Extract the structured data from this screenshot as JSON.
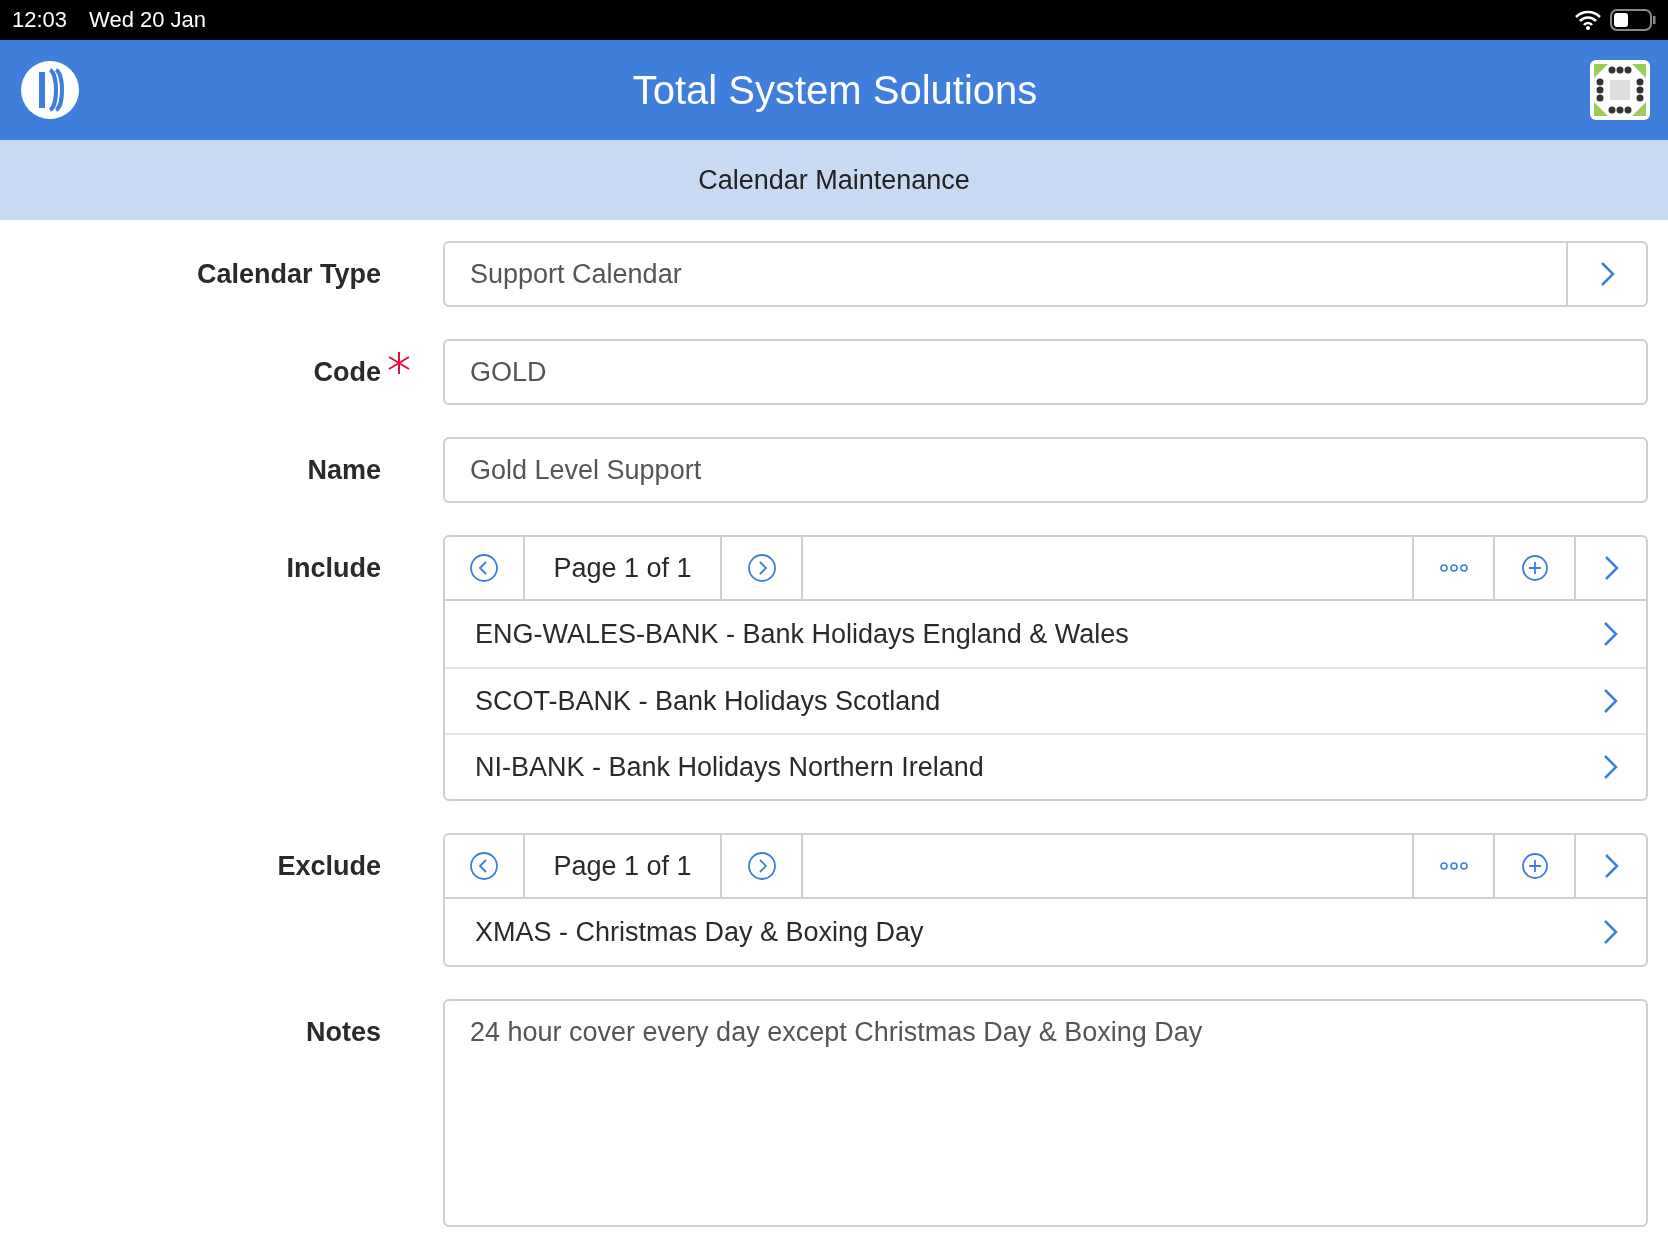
{
  "status_bar": {
    "time": "12:03",
    "date": "Wed 20 Jan"
  },
  "header": {
    "title": "Total System Solutions"
  },
  "subheader": {
    "title": "Calendar Maintenance"
  },
  "fields": [
    {
      "kind": "select",
      "label": "Calendar Type",
      "value": "Support Calendar",
      "required": false
    },
    {
      "kind": "text",
      "label": "Code",
      "value": "GOLD",
      "required": true
    },
    {
      "kind": "text",
      "label": "Name",
      "value": "Gold Level Support",
      "required": false
    },
    {
      "kind": "list",
      "label": "Include",
      "pager": "Page 1 of 1",
      "items": [
        "ENG-WALES-BANK - Bank Holidays England & Wales",
        "SCOT-BANK - Bank Holidays Scotland",
        "NI-BANK - Bank Holidays Northern Ireland"
      ]
    },
    {
      "kind": "list",
      "label": "Exclude",
      "pager": "Page 1 of 1",
      "items": [
        "XMAS - Christmas Day & Boxing Day"
      ]
    },
    {
      "kind": "textarea",
      "label": "Notes",
      "value": "24 hour cover every day except Christmas Day & Boxing Day",
      "required": false
    }
  ]
}
